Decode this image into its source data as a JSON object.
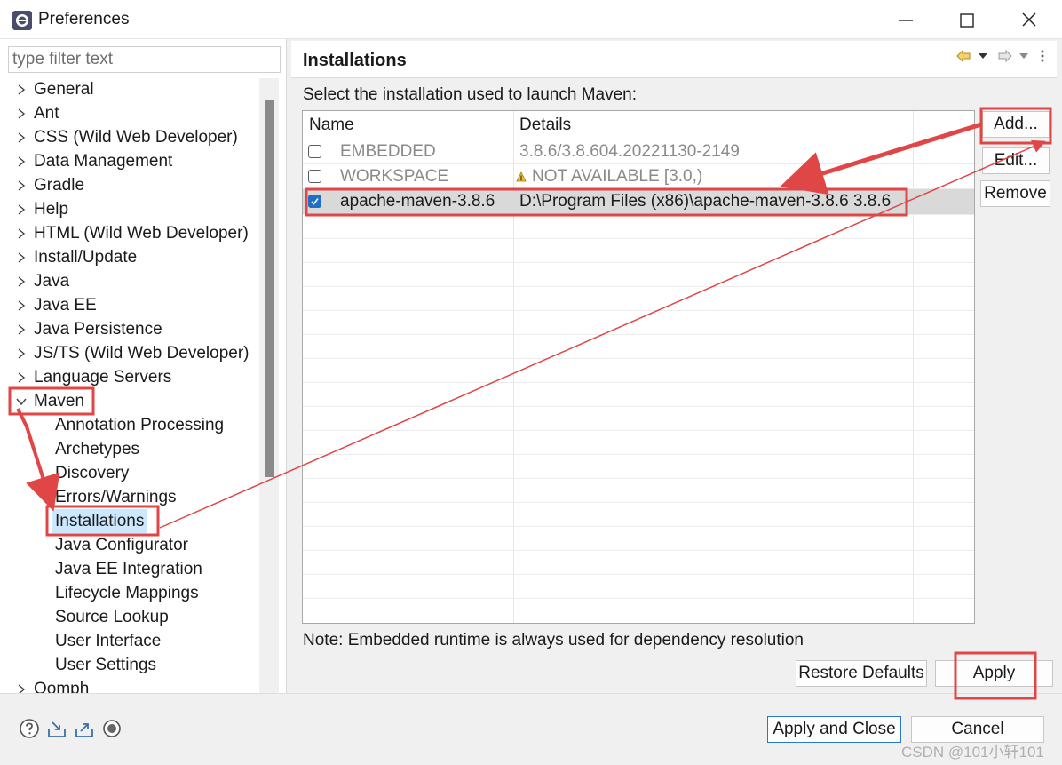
{
  "window": {
    "title": "Preferences"
  },
  "sidebar": {
    "filter_placeholder": "type filter text",
    "items": [
      {
        "label": "General",
        "level": 0,
        "state": "collapsed"
      },
      {
        "label": "Ant",
        "level": 0,
        "state": "collapsed"
      },
      {
        "label": "CSS (Wild Web Developer)",
        "level": 0,
        "state": "collapsed"
      },
      {
        "label": "Data Management",
        "level": 0,
        "state": "collapsed"
      },
      {
        "label": "Gradle",
        "level": 0,
        "state": "collapsed"
      },
      {
        "label": "Help",
        "level": 0,
        "state": "collapsed"
      },
      {
        "label": "HTML (Wild Web Developer)",
        "level": 0,
        "state": "collapsed"
      },
      {
        "label": "Install/Update",
        "level": 0,
        "state": "collapsed"
      },
      {
        "label": "Java",
        "level": 0,
        "state": "collapsed"
      },
      {
        "label": "Java EE",
        "level": 0,
        "state": "collapsed"
      },
      {
        "label": "Java Persistence",
        "level": 0,
        "state": "collapsed"
      },
      {
        "label": "JS/TS (Wild Web Developer)",
        "level": 0,
        "state": "collapsed"
      },
      {
        "label": "Language Servers",
        "level": 0,
        "state": "collapsed"
      },
      {
        "label": "Maven",
        "level": 0,
        "state": "expanded"
      },
      {
        "label": "Annotation Processing",
        "level": 1
      },
      {
        "label": "Archetypes",
        "level": 1
      },
      {
        "label": "Discovery",
        "level": 1
      },
      {
        "label": "Errors/Warnings",
        "level": 1
      },
      {
        "label": "Installations",
        "level": 1,
        "selected": true
      },
      {
        "label": "Java Configurator",
        "level": 1
      },
      {
        "label": "Java EE Integration",
        "level": 1
      },
      {
        "label": "Lifecycle Mappings",
        "level": 1
      },
      {
        "label": "Source Lookup",
        "level": 1
      },
      {
        "label": "User Interface",
        "level": 1
      },
      {
        "label": "User Settings",
        "level": 1
      },
      {
        "label": "Oomph",
        "level": 0,
        "state": "collapsed"
      }
    ]
  },
  "page": {
    "title": "Installations",
    "description": "Select the installation used to launch Maven:",
    "table": {
      "columns": [
        "Name",
        "Details"
      ],
      "rows": [
        {
          "name": "EMBEDDED",
          "details": "3.8.6/3.8.604.20221130-2149",
          "checked": false,
          "muted": true,
          "warning": false
        },
        {
          "name": "WORKSPACE",
          "details": "NOT AVAILABLE [3.0,)",
          "checked": false,
          "muted": true,
          "warning": true
        },
        {
          "name": "apache-maven-3.8.6",
          "details": "D:\\Program Files (x86)\\apache-maven-3.8.6 3.8.6",
          "checked": true,
          "muted": false,
          "warning": false
        }
      ]
    },
    "side_buttons": {
      "add": "Add...",
      "edit": "Edit...",
      "remove": "Remove"
    },
    "note": "Note: Embedded runtime is always used for dependency resolution",
    "restore_defaults": "Restore Defaults",
    "apply": "Apply"
  },
  "footer": {
    "apply_and_close": "Apply and Close",
    "cancel": "Cancel"
  },
  "watermark": "CSDN @101小轩101",
  "colors": {
    "annotation": "#e04646",
    "selection": "#cce8ff",
    "checkbox_checked": "#1f6fc6"
  }
}
